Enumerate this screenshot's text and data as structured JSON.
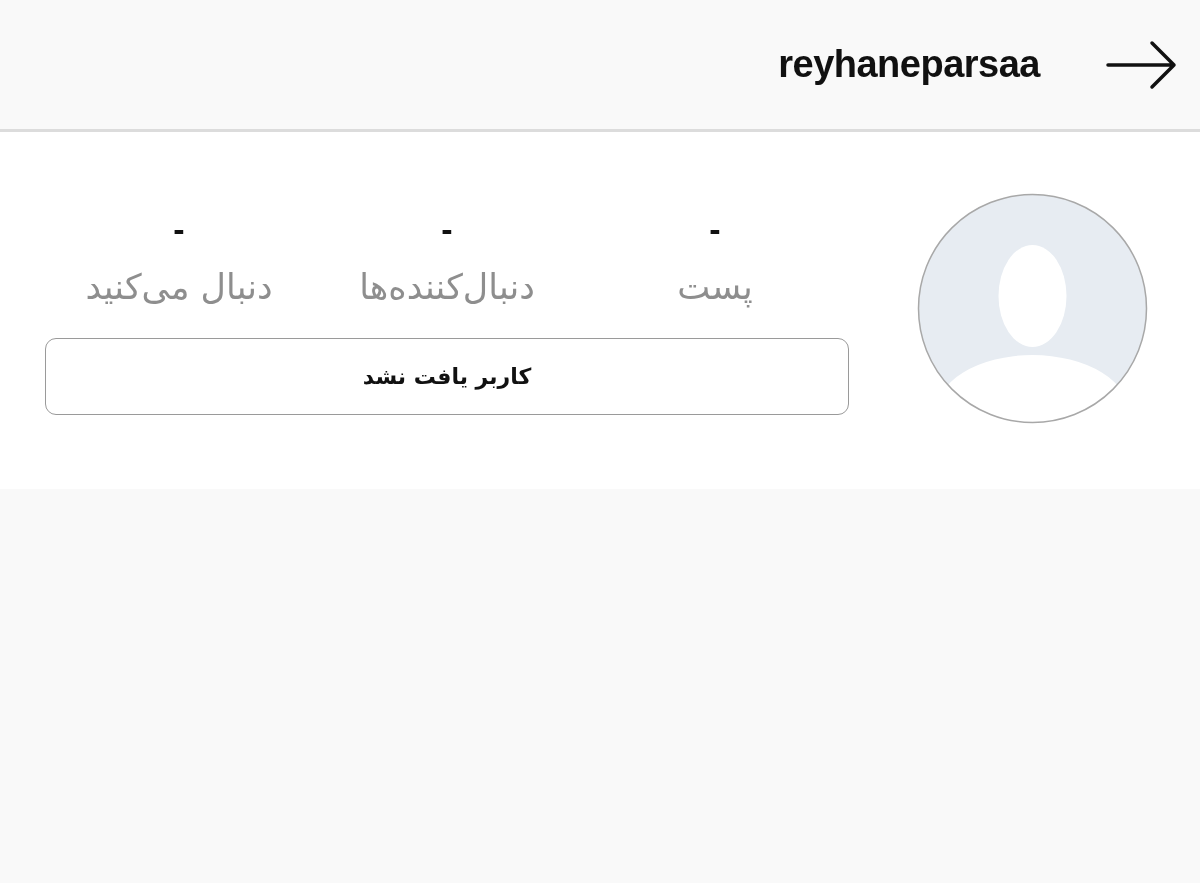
{
  "header": {
    "username": "reyhaneparsaa"
  },
  "profile": {
    "stats": [
      {
        "value": "-",
        "label": "پست"
      },
      {
        "value": "-",
        "label": "دنبال‌کننده‌ها"
      },
      {
        "value": "-",
        "label": "دنبال می‌کنید"
      }
    ],
    "status_button": "کاربر یافت نشد"
  }
}
